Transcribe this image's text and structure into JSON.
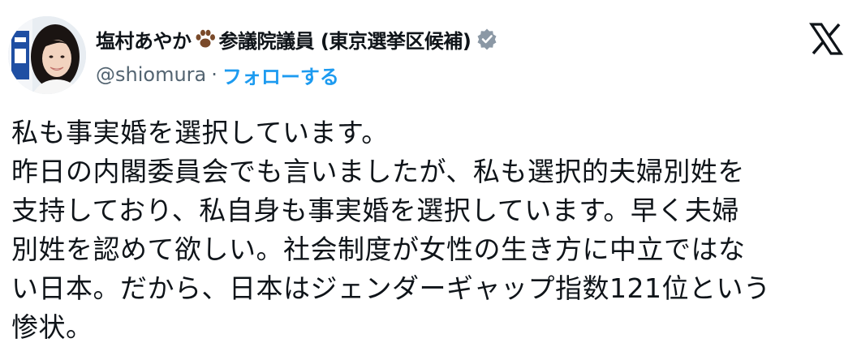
{
  "author": {
    "display_name_part1": "塩村あやか",
    "display_name_part2": "参議院議員 (東京選挙区候補)",
    "handle": "@shiomura",
    "separator": "·",
    "follow_label": "フォローする",
    "paw_icon": "paw-icon",
    "verified_icon": "verified-badge-icon",
    "verified_color": "#8b98a5"
  },
  "brand": {
    "logo": "x-logo-icon",
    "color": "#0f1419"
  },
  "tweet": {
    "lines": [
      "私も事実婚を選択しています。",
      "昨日の内閣委員会でも言いましたが、私も選択的夫婦別姓を",
      "支持しており、私自身も事実婚を選択しています。早く夫婦",
      "別姓を認めて欲しい。社会制度が女性の生き方に中立ではな",
      "い日本。だから、日本はジェンダーギャップ指数121位という",
      "惨状。"
    ]
  },
  "colors": {
    "link": "#1d9bf0",
    "secondary_text": "#536471",
    "primary_text": "#0f1419"
  }
}
